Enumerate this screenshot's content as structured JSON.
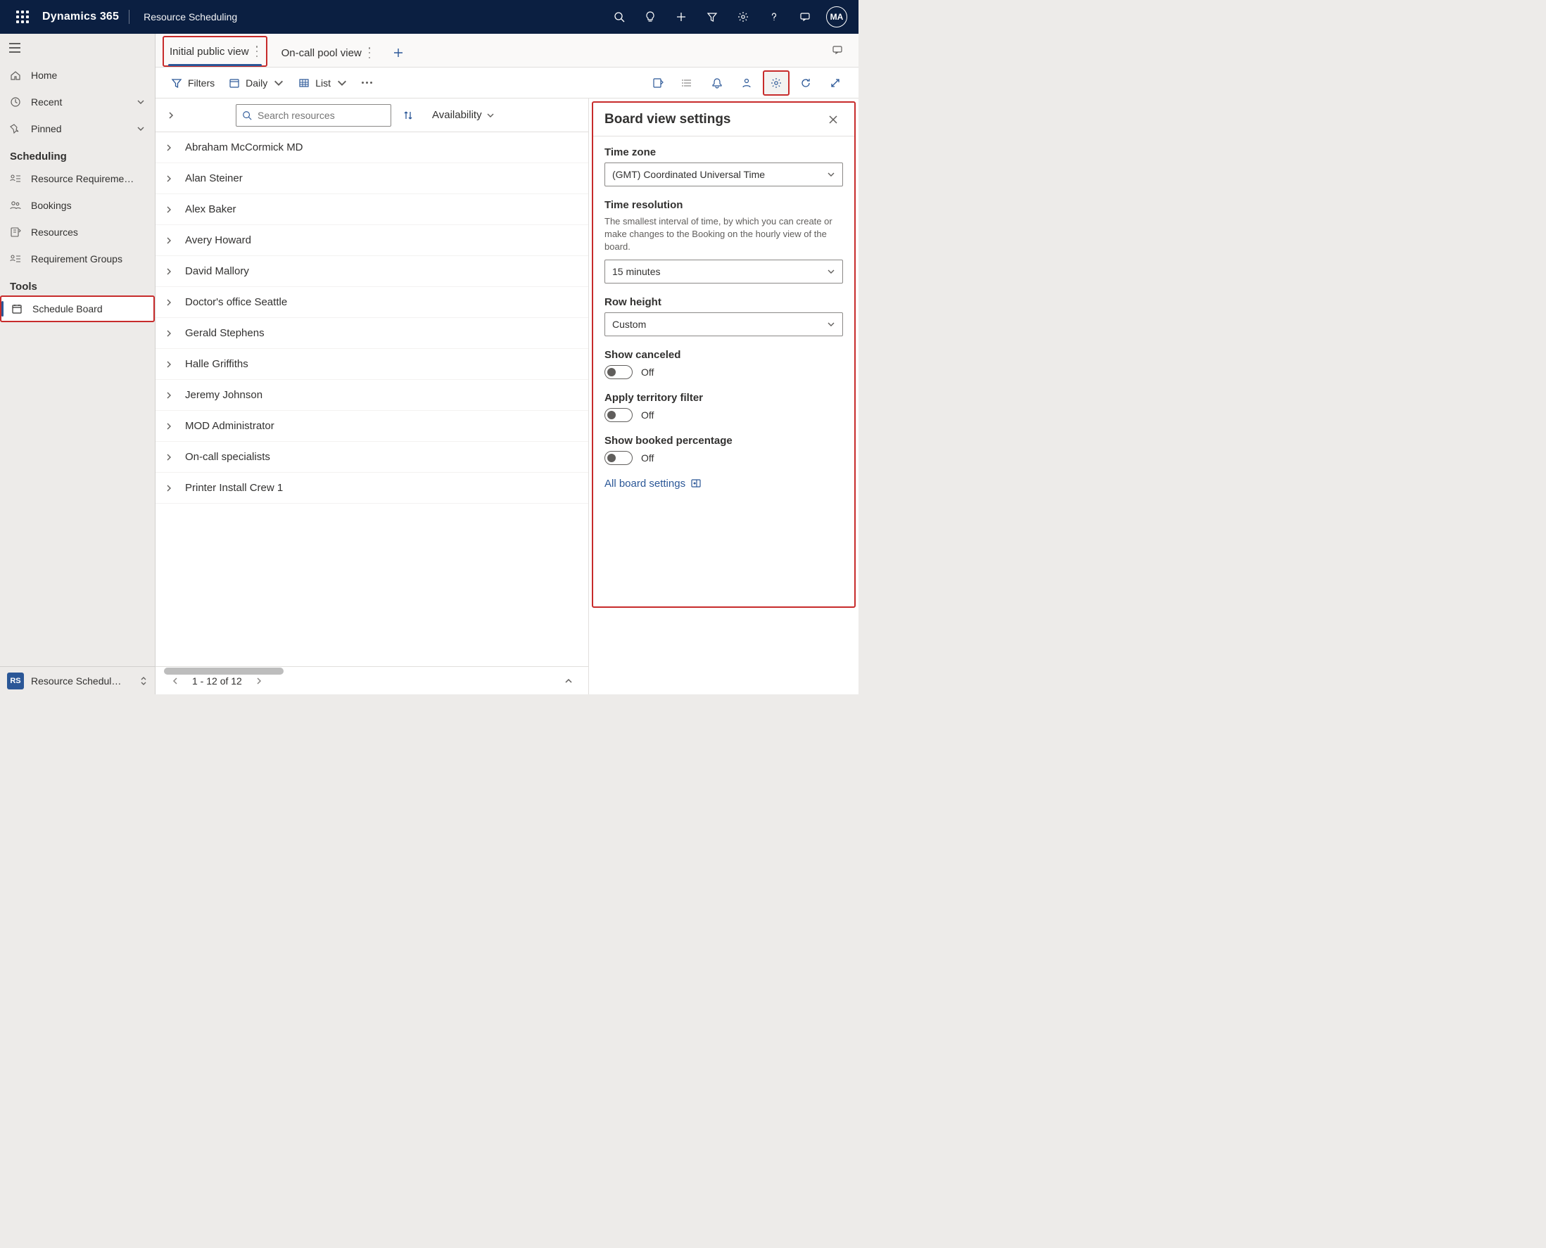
{
  "header": {
    "brand": "Dynamics 365",
    "app": "Resource Scheduling",
    "avatar": "MA"
  },
  "nav": {
    "home": "Home",
    "recent": "Recent",
    "pinned": "Pinned",
    "scheduling_section": "Scheduling",
    "resource_reqs": "Resource Requireme…",
    "bookings": "Bookings",
    "resources": "Resources",
    "requirement_groups": "Requirement Groups",
    "tools_section": "Tools",
    "schedule_board": "Schedule Board",
    "area_badge": "RS",
    "area_label": "Resource Schedul…"
  },
  "tabs": {
    "initial": "Initial public view",
    "oncall": "On-call pool view"
  },
  "commands": {
    "filters": "Filters",
    "daily": "Daily",
    "list": "List"
  },
  "search": {
    "placeholder": "Search resources",
    "availability": "Availability"
  },
  "resources": [
    "Abraham McCormick MD",
    "Alan Steiner",
    "Alex Baker",
    "Avery Howard",
    "David Mallory",
    "Doctor's office Seattle",
    "Gerald Stephens",
    "Halle Griffiths",
    "Jeremy Johnson",
    "MOD Administrator",
    "On-call specialists",
    "Printer Install Crew 1"
  ],
  "pager": {
    "text": "1 - 12 of 12"
  },
  "panel": {
    "title": "Board view settings",
    "timezone_label": "Time zone",
    "timezone_value": "(GMT) Coordinated Universal Time",
    "timeres_label": "Time resolution",
    "timeres_desc": "The smallest interval of time, by which you can create or make changes to the Booking on the hourly view of the board.",
    "timeres_value": "15 minutes",
    "rowheight_label": "Row height",
    "rowheight_value": "Custom",
    "show_canceled_label": "Show canceled",
    "show_canceled_value": "Off",
    "territory_label": "Apply territory filter",
    "territory_value": "Off",
    "booked_pct_label": "Show booked percentage",
    "booked_pct_value": "Off",
    "all_settings": "All board settings"
  }
}
